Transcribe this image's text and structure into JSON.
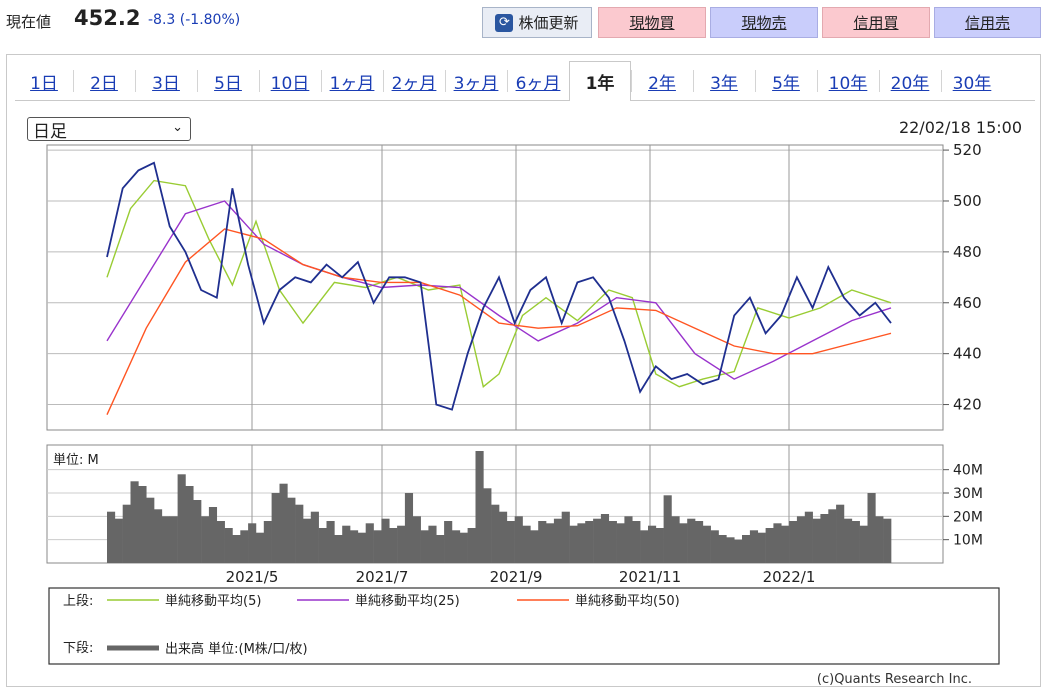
{
  "header": {
    "price_label": "現在値",
    "price_value": "452.2",
    "price_change": "-8.3 (-1.80%)",
    "update_button": "株価更新",
    "update_icon": "refresh-icon",
    "buttons": [
      "現物買",
      "現物売",
      "信用買",
      "信用売"
    ],
    "colors": {
      "buy": "#fbc9cf",
      "sell": "#c9cdfb",
      "change": "#1a3db5"
    }
  },
  "tabs": [
    "1日",
    "2日",
    "3日",
    "5日",
    "10日",
    "1ヶ月",
    "2ヶ月",
    "3ヶ月",
    "6ヶ月",
    "1年",
    "2年",
    "3年",
    "5年",
    "10年",
    "20年",
    "30年"
  ],
  "active_tab": "1年",
  "select": {
    "value": "日足"
  },
  "timestamp": "22/02/18 15:00",
  "chart_data": [
    {
      "type": "line",
      "series": [
        {
          "name": "単純移動平均(5)",
          "color": "#99cc33",
          "x": [
            0,
            0.03,
            0.06,
            0.1,
            0.13,
            0.16,
            0.19,
            0.22,
            0.25,
            0.29,
            0.33,
            0.37,
            0.41,
            0.45,
            0.48,
            0.5,
            0.53,
            0.56,
            0.6,
            0.64,
            0.67,
            0.7,
            0.73,
            0.76,
            0.8,
            0.83,
            0.87,
            0.91,
            0.95,
            1.0
          ],
          "values": [
            470,
            497,
            508,
            506,
            485,
            467,
            492,
            465,
            452,
            468,
            466,
            470,
            465,
            467,
            427,
            432,
            455,
            462,
            453,
            465,
            462,
            432,
            427,
            430,
            433,
            458,
            454,
            458,
            465,
            460
          ]
        },
        {
          "name": "単純移動平均(25)",
          "color": "#9933cc",
          "x": [
            0,
            0.05,
            0.1,
            0.15,
            0.2,
            0.25,
            0.3,
            0.35,
            0.4,
            0.45,
            0.5,
            0.55,
            0.6,
            0.65,
            0.7,
            0.75,
            0.8,
            0.85,
            0.9,
            0.95,
            1.0
          ],
          "values": [
            445,
            470,
            495,
            500,
            483,
            475,
            470,
            466,
            467,
            466,
            455,
            445,
            452,
            462,
            460,
            440,
            430,
            437,
            445,
            453,
            458
          ]
        },
        {
          "name": "単純移動平均(50)",
          "color": "#ff5522",
          "x": [
            0,
            0.05,
            0.1,
            0.15,
            0.2,
            0.25,
            0.3,
            0.35,
            0.4,
            0.45,
            0.5,
            0.55,
            0.6,
            0.65,
            0.7,
            0.75,
            0.8,
            0.85,
            0.9,
            0.95,
            1.0
          ],
          "values": [
            416,
            450,
            476,
            489,
            485,
            475,
            470,
            468,
            468,
            463,
            452,
            450,
            451,
            458,
            457,
            450,
            443,
            440,
            440,
            444,
            448
          ]
        },
        {
          "name": "",
          "color": "#1f2f8f",
          "x": [
            0,
            0.02,
            0.04,
            0.06,
            0.08,
            0.1,
            0.12,
            0.14,
            0.16,
            0.18,
            0.2,
            0.22,
            0.24,
            0.26,
            0.28,
            0.3,
            0.32,
            0.34,
            0.36,
            0.38,
            0.4,
            0.42,
            0.44,
            0.46,
            0.48,
            0.5,
            0.52,
            0.54,
            0.56,
            0.58,
            0.6,
            0.62,
            0.64,
            0.66,
            0.68,
            0.7,
            0.72,
            0.74,
            0.76,
            0.78,
            0.8,
            0.82,
            0.84,
            0.86,
            0.88,
            0.9,
            0.92,
            0.94,
            0.96,
            0.98,
            1.0
          ],
          "values": [
            478,
            505,
            512,
            515,
            490,
            480,
            465,
            462,
            505,
            475,
            452,
            465,
            470,
            468,
            475,
            470,
            476,
            460,
            470,
            470,
            468,
            420,
            418,
            440,
            458,
            470,
            452,
            465,
            470,
            452,
            468,
            470,
            462,
            445,
            425,
            435,
            430,
            432,
            428,
            430,
            455,
            462,
            448,
            455,
            470,
            458,
            474,
            462,
            455,
            460,
            452
          ]
        }
      ],
      "ylim": [
        410,
        522
      ],
      "yticks": [
        420,
        440,
        460,
        480,
        500,
        520
      ]
    },
    {
      "type": "bar",
      "unit_label": "単位: M",
      "values": [
        22,
        19,
        25,
        35,
        33,
        28,
        23,
        20,
        20,
        38,
        33,
        27,
        20,
        24,
        18,
        15,
        12,
        14,
        17,
        13,
        18,
        30,
        34,
        28,
        25,
        19,
        22,
        15,
        18,
        12,
        16,
        14,
        13,
        17,
        14,
        19,
        15,
        16,
        30,
        20,
        14,
        16,
        12,
        18,
        14,
        13,
        15,
        48,
        32,
        25,
        22,
        18,
        20,
        16,
        14,
        18,
        17,
        19,
        22,
        16,
        17,
        18,
        19,
        21,
        18,
        17,
        20,
        18,
        14,
        16,
        15,
        29,
        20,
        17,
        19,
        18,
        16,
        14,
        12,
        11,
        10,
        12,
        14,
        13,
        15,
        17,
        16,
        18,
        20,
        22,
        19,
        21,
        23,
        25,
        19,
        18,
        16,
        30,
        20,
        19
      ],
      "ylim": [
        0,
        48
      ],
      "yticks": [
        "10M",
        "20M",
        "30M",
        "40M"
      ]
    }
  ],
  "x_labels": [
    "2021/5",
    "2021/7",
    "2021/9",
    "2021/11",
    "2022/1"
  ],
  "legend": {
    "upper_label": "上段:",
    "lower_label": "下段:",
    "items": [
      "単純移動平均(5)",
      "単純移動平均(25)",
      "単純移動平均(50)"
    ],
    "volume_label": "出来高 単位:(M株/口/枚)"
  },
  "copyright": "(c)Quants Research Inc."
}
